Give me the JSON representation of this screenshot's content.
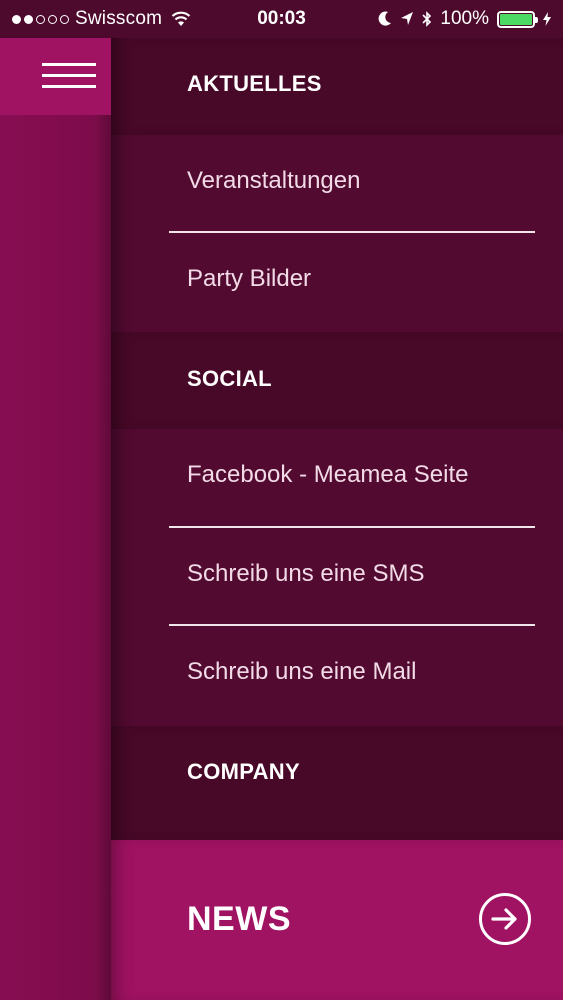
{
  "status_bar": {
    "carrier": "Swisscom",
    "time": "00:03",
    "battery": "100%",
    "battery_color": "#4cd964",
    "signal_bars_filled": 2,
    "signal_bars_total": 5
  },
  "menu": {
    "sections": [
      {
        "title": "AKTUELLES",
        "items": [
          "Veranstaltungen",
          "Party Bilder"
        ]
      },
      {
        "title": "SOCIAL",
        "items": [
          "Facebook - Meamea Seite",
          "Schreib uns eine SMS",
          "Schreib uns eine Mail"
        ]
      },
      {
        "title": "COMPANY",
        "items": []
      }
    ]
  },
  "bottom_bar": {
    "label": "NEWS",
    "icon": "arrow-right-circle-icon"
  },
  "colors": {
    "accent": "#a01262",
    "drawer_bg": "#520a30",
    "section_bg": "#480828"
  }
}
